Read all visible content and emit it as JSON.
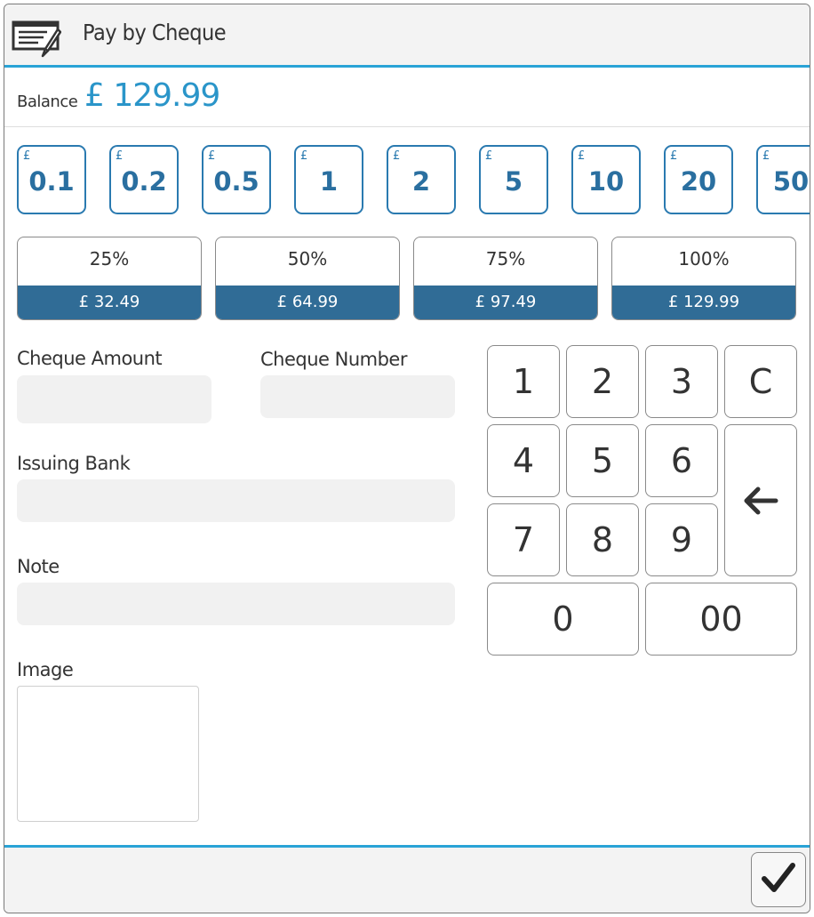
{
  "header": {
    "title": "Pay by Cheque",
    "icon": "cheque-pen-icon"
  },
  "balance": {
    "label": "Balance",
    "value": "£ 129.99"
  },
  "denominations": {
    "currency": "£",
    "values": [
      "0.1",
      "0.2",
      "0.5",
      "1",
      "2",
      "5",
      "10",
      "20",
      "50"
    ]
  },
  "percentages": [
    {
      "label": "25%",
      "amount": "£ 32.49"
    },
    {
      "label": "50%",
      "amount": "£ 64.99"
    },
    {
      "label": "75%",
      "amount": "£ 97.49"
    },
    {
      "label": "100%",
      "amount": "£ 129.99"
    }
  ],
  "form": {
    "cheque_amount_label": "Cheque Amount",
    "cheque_amount_value": "",
    "cheque_number_label": "Cheque Number",
    "cheque_number_value": "",
    "issuing_bank_label": "Issuing Bank",
    "issuing_bank_value": "",
    "note_label": "Note",
    "note_value": "",
    "image_label": "Image"
  },
  "keypad": {
    "k1": "1",
    "k2": "2",
    "k3": "3",
    "clear": "C",
    "k4": "4",
    "k5": "5",
    "k6": "6",
    "k7": "7",
    "k8": "8",
    "k9": "9",
    "k0": "0",
    "k00": "00",
    "backspace_icon": "arrow-left-icon"
  },
  "footer": {
    "confirm_icon": "checkmark-icon"
  },
  "colors": {
    "accent": "#29a3d6",
    "denom_border": "#2a7ab0",
    "pct_fill": "#306c96",
    "field_bg": "#f1f1f1"
  }
}
